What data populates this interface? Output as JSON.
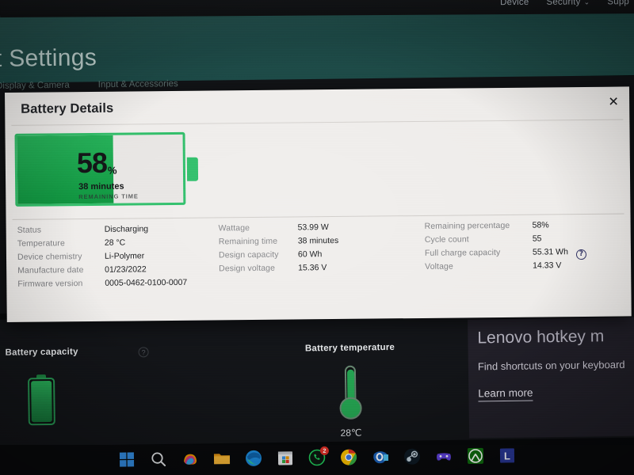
{
  "topnav": {
    "items": [
      {
        "label": "Device",
        "has_chevron": false
      },
      {
        "label": "Security",
        "has_chevron": true
      },
      {
        "label": "Supp",
        "has_chevron": false
      }
    ],
    "chevron_glyph": "⌄"
  },
  "app": {
    "title": "art Settings",
    "tabs": [
      {
        "label": "Display & Camera"
      },
      {
        "label": "Input & Accessories"
      }
    ],
    "header_color": "#20514d"
  },
  "dialog": {
    "title": "Battery Details",
    "close_glyph": "✕",
    "gauge": {
      "percent_number": "58",
      "percent_symbol": "%",
      "percent_fill": 58,
      "remaining_time": "38 minutes",
      "remaining_caption": "REMAINING TIME",
      "fill_color": "#1aa74c",
      "outline_color": "#35c16f"
    },
    "columns": [
      {
        "name": "left",
        "rows": [
          {
            "key": "Status",
            "value": "Discharging"
          },
          {
            "key": "Temperature",
            "value": "28 °C"
          },
          {
            "key": "Device chemistry",
            "value": "Li-Polymer"
          },
          {
            "key": "Manufacture date",
            "value": "01/23/2022"
          },
          {
            "key": "Firmware version",
            "value": "0005-0462-0100-0007"
          }
        ]
      },
      {
        "name": "middle",
        "rows": [
          {
            "key": "Wattage",
            "value": "53.99 W"
          },
          {
            "key": "Remaining time",
            "value": "38 minutes"
          },
          {
            "key": "Design capacity",
            "value": "60 Wh"
          },
          {
            "key": "Design voltage",
            "value": "15.36 V"
          }
        ]
      },
      {
        "name": "right",
        "rows": [
          {
            "key": "Remaining percentage",
            "value": "58%",
            "help": false
          },
          {
            "key": "Cycle count",
            "value": "55",
            "help": false
          },
          {
            "key": "Full charge capacity",
            "value": "55.31 Wh",
            "help": true
          },
          {
            "key": "Voltage",
            "value": "14.33 V",
            "help": false
          }
        ]
      }
    ],
    "help_glyph": "?"
  },
  "dashboard": {
    "battery_capacity": {
      "label": "Battery capacity",
      "help_glyph": "?",
      "fill_percent": 100
    },
    "battery_temperature": {
      "label": "Battery temperature",
      "value": "28℃"
    },
    "hotkey_card": {
      "title": "Lenovo hotkey m",
      "subtitle": "Find shortcuts on your keyboard",
      "link": "Learn more"
    }
  },
  "taskbar": {
    "icons": [
      {
        "name": "windows-start-icon",
        "badge": null
      },
      {
        "name": "search-icon",
        "badge": null
      },
      {
        "name": "copilot-icon",
        "badge": null
      },
      {
        "name": "file-explorer-icon",
        "badge": null
      },
      {
        "name": "edge-icon",
        "badge": null
      },
      {
        "name": "microsoft-store-icon",
        "badge": null
      },
      {
        "name": "whatsapp-icon",
        "badge": "2"
      },
      {
        "name": "chrome-icon",
        "badge": null
      },
      {
        "name": "outlook-icon",
        "badge": null
      },
      {
        "name": "steam-icon",
        "badge": null
      },
      {
        "name": "xbox-gamebar-icon",
        "badge": null
      },
      {
        "name": "xbox-icon",
        "badge": null
      },
      {
        "name": "lenovo-icon",
        "badge": null
      }
    ]
  }
}
